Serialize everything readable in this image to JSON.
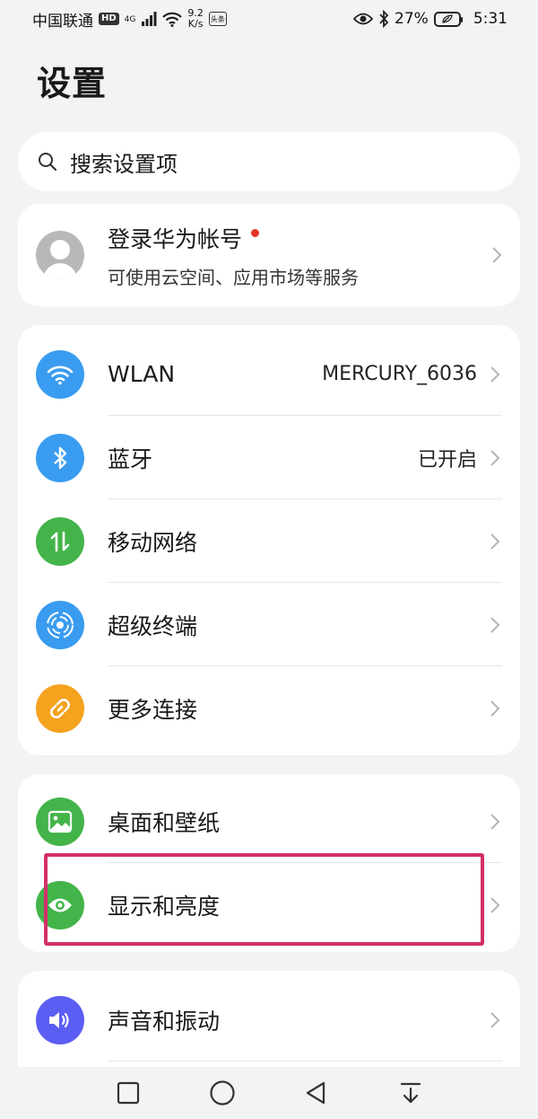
{
  "status_bar": {
    "carrier": "中国联通",
    "hd": "HD",
    "network": "4G",
    "speed_value": "9.2",
    "speed_unit": "K/s",
    "app_badge": "头条",
    "battery": "27%",
    "time": "5:31"
  },
  "page": {
    "title": "设置"
  },
  "search": {
    "placeholder": "搜索设置项"
  },
  "account": {
    "title": "登录华为帐号",
    "subtitle": "可使用云空间、应用市场等服务"
  },
  "connections": {
    "items": [
      {
        "label": "WLAN",
        "value": "MERCURY_6036",
        "icon": "wifi-icon",
        "color": "#3a9cf0"
      },
      {
        "label": "蓝牙",
        "value": "已开启",
        "icon": "bluetooth-icon",
        "color": "#3a9cf0"
      },
      {
        "label": "移动网络",
        "value": "",
        "icon": "mobile-data-icon",
        "color": "#43b449"
      },
      {
        "label": "超级终端",
        "value": "",
        "icon": "super-device-icon",
        "color": "#3a9cf0"
      },
      {
        "label": "更多连接",
        "value": "",
        "icon": "link-icon",
        "color": "#f5a21e"
      }
    ]
  },
  "display": {
    "items": [
      {
        "label": "桌面和壁纸",
        "icon": "wallpaper-icon",
        "color": "#43b449"
      },
      {
        "label": "显示和亮度",
        "icon": "eye-icon",
        "color": "#43b449"
      }
    ]
  },
  "sound": {
    "items": [
      {
        "label": "声音和振动",
        "icon": "speaker-icon",
        "color": "#5b5ef2"
      }
    ]
  },
  "colors": {
    "highlight": "#d2306a",
    "background": "#f1f3f5",
    "red_dot": "#e5352b"
  }
}
